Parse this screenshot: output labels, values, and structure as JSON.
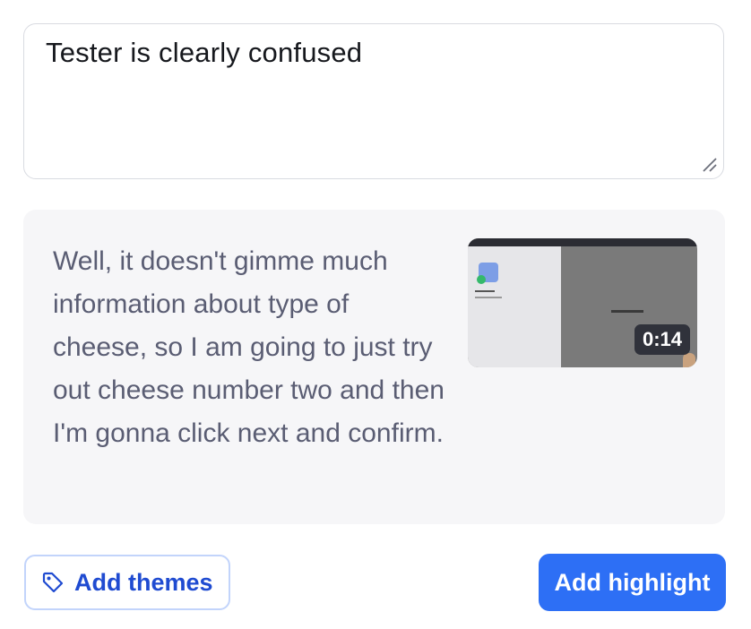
{
  "note": {
    "text": "Tester is clearly confused"
  },
  "transcript": {
    "text": "Well, it doesn't gimme much information about type of cheese, so I am going to just try out cheese number two and then I'm gonna click next and confirm.",
    "video_duration": "0:14"
  },
  "actions": {
    "add_themes_label": "Add themes",
    "add_highlight_label": "Add highlight"
  },
  "icons": {
    "themes": "tag-icon",
    "resize": "resize-handle-icon"
  },
  "colors": {
    "primary": "#2d6ff5",
    "primary_text": "#1f4bd1",
    "card_bg": "#f6f6f8",
    "transcript_text": "#5a5d73"
  }
}
